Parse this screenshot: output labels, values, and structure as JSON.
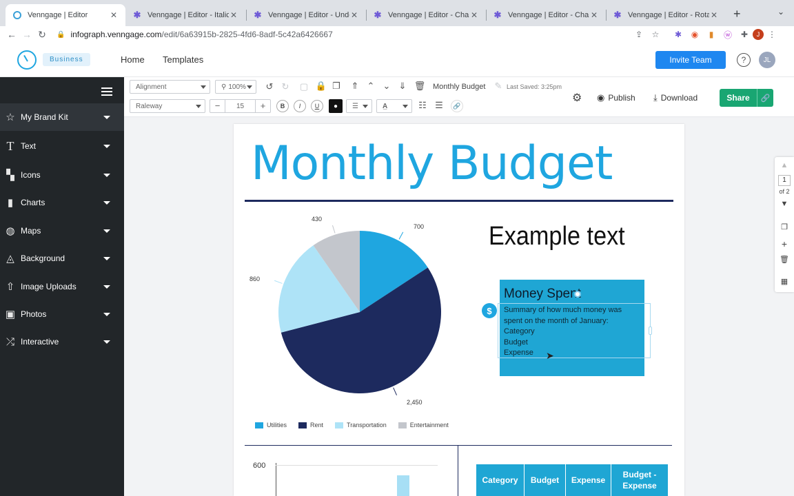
{
  "browser": {
    "tabs": [
      {
        "title": "Venngage | Editor",
        "active": true
      },
      {
        "title": "Venngage | Editor - Italicize",
        "active": false
      },
      {
        "title": "Venngage | Editor - Underli",
        "active": false
      },
      {
        "title": "Venngage | Editor - Change",
        "active": false
      },
      {
        "title": "Venngage | Editor - Change",
        "active": false
      },
      {
        "title": "Venngage | Editor - Rotate",
        "active": false
      }
    ],
    "url_host": "infograph.venngage.com",
    "url_path": "/edit/6a63915b-2825-4fd6-8adf-5c42a6426667",
    "profile_initial": "J"
  },
  "header": {
    "plan_badge": "Business",
    "nav": [
      "Home",
      "Templates"
    ],
    "invite_label": "Invite Team",
    "help_label": "?",
    "avatar_initials": "JL"
  },
  "sidebar": {
    "items": [
      {
        "label": "My Brand Kit",
        "icon": "star-icon"
      },
      {
        "label": "Text",
        "icon": "text-icon"
      },
      {
        "label": "Icons",
        "icon": "icons-grid-icon"
      },
      {
        "label": "Charts",
        "icon": "bar-chart-icon"
      },
      {
        "label": "Maps",
        "icon": "globe-icon"
      },
      {
        "label": "Background",
        "icon": "bucket-icon"
      },
      {
        "label": "Image Uploads",
        "icon": "upload-icon"
      },
      {
        "label": "Photos",
        "icon": "photo-icon"
      },
      {
        "label": "Interactive",
        "icon": "shuffle-icon"
      }
    ]
  },
  "toolbar": {
    "alignment_placeholder": "Alignment",
    "zoom": "100%",
    "font": "Raleway",
    "font_size": "15",
    "doc_name": "Monthly Budget",
    "last_saved": "Last Saved: 3:25pm",
    "publish_label": "Publish",
    "download_label": "Download",
    "share_label": "Share",
    "bold": "B",
    "italic": "I",
    "underline": "U"
  },
  "canvas": {
    "title": "Monthly Budget",
    "example_text": "Example text",
    "money_box": {
      "title": "Money Spent",
      "summary": "Summary of how much money was spent on the month of January:",
      "lines": [
        "Category",
        "Budget",
        "Expense"
      ]
    },
    "bar_tick": "600",
    "table_headers": [
      "Category",
      "Budget",
      "Expense",
      "Budget - Expense"
    ]
  },
  "chart_data": {
    "type": "pie",
    "categories": [
      "Utilities",
      "Rent",
      "Transportation",
      "Entertainment"
    ],
    "values": [
      700,
      2450,
      860,
      430
    ],
    "labels": [
      "700",
      "2,450",
      "860",
      "430"
    ],
    "colors": [
      "#1fa6e0",
      "#1d2a5e",
      "#aee3f7",
      "#c3c6cc"
    ],
    "legend_position": "bottom"
  },
  "page_panel": {
    "page": "1",
    "of": "of 2"
  }
}
